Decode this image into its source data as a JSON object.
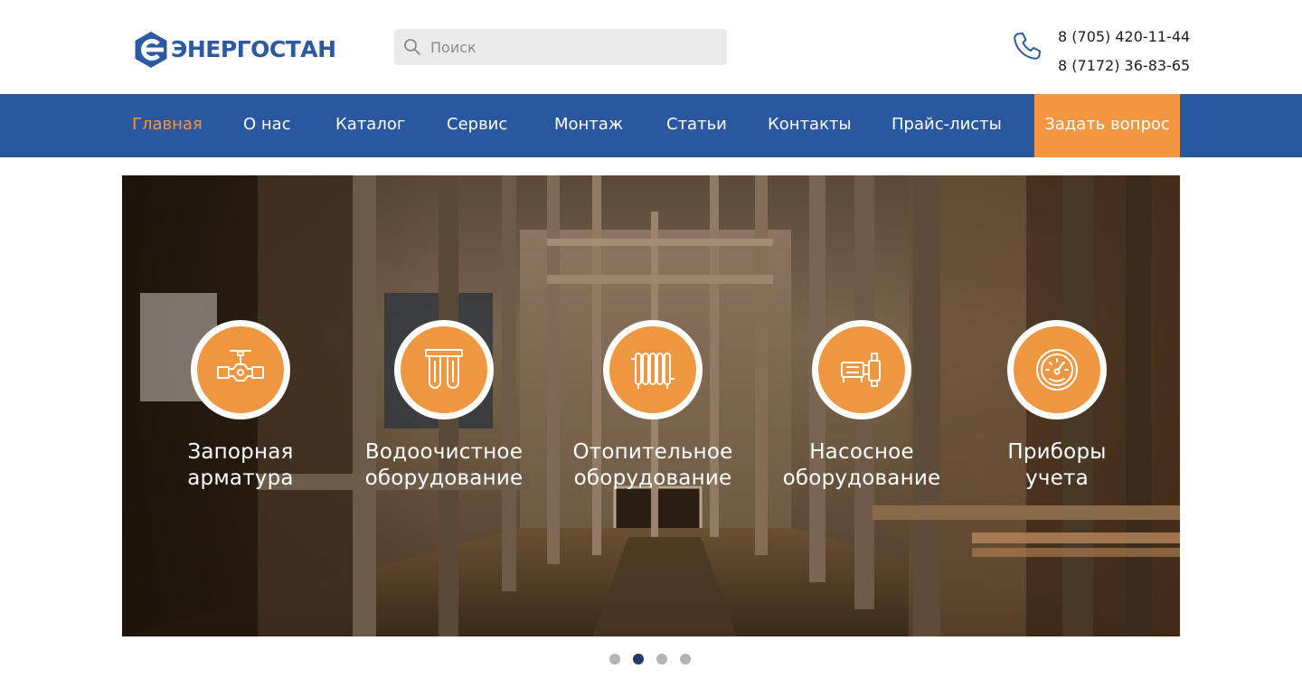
{
  "brand": {
    "name": "ЭНЕРГОСТАН",
    "color": "#2a5aa1",
    "logo_icon": "hexagon-c-icon"
  },
  "search": {
    "placeholder": "Поиск",
    "value": ""
  },
  "contacts": {
    "phones": [
      "8 (705) 420-11-44",
      "8 (7172) 36-83-65"
    ],
    "icon": "phone-icon"
  },
  "nav": {
    "items": [
      {
        "label": "Главная",
        "active": true
      },
      {
        "label": "О нас",
        "active": false
      },
      {
        "label": "Каталог",
        "active": false
      },
      {
        "label": "Сервис",
        "active": false
      },
      {
        "label": "Монтаж",
        "active": false
      },
      {
        "label": "Статьи",
        "active": false
      },
      {
        "label": "Контакты",
        "active": false
      },
      {
        "label": "Прайс-листы",
        "active": false
      }
    ],
    "cta": "Задать вопрос",
    "background": "#2a58a0",
    "accent": "#f2973f"
  },
  "banner": {
    "categories": [
      {
        "label": [
          "Запорная",
          "арматура"
        ],
        "icon": "valve-icon"
      },
      {
        "label": [
          "Водоочистное",
          "оборудование"
        ],
        "icon": "water-filter-icon"
      },
      {
        "label": [
          "Отопительное",
          "оборудование"
        ],
        "icon": "radiator-icon"
      },
      {
        "label": [
          "Насосное",
          "оборудование"
        ],
        "icon": "pump-icon"
      },
      {
        "label": [
          "Приборы",
          "учета"
        ],
        "icon": "gauge-icon"
      }
    ]
  },
  "slider": {
    "count": 4,
    "active_index": 1
  }
}
